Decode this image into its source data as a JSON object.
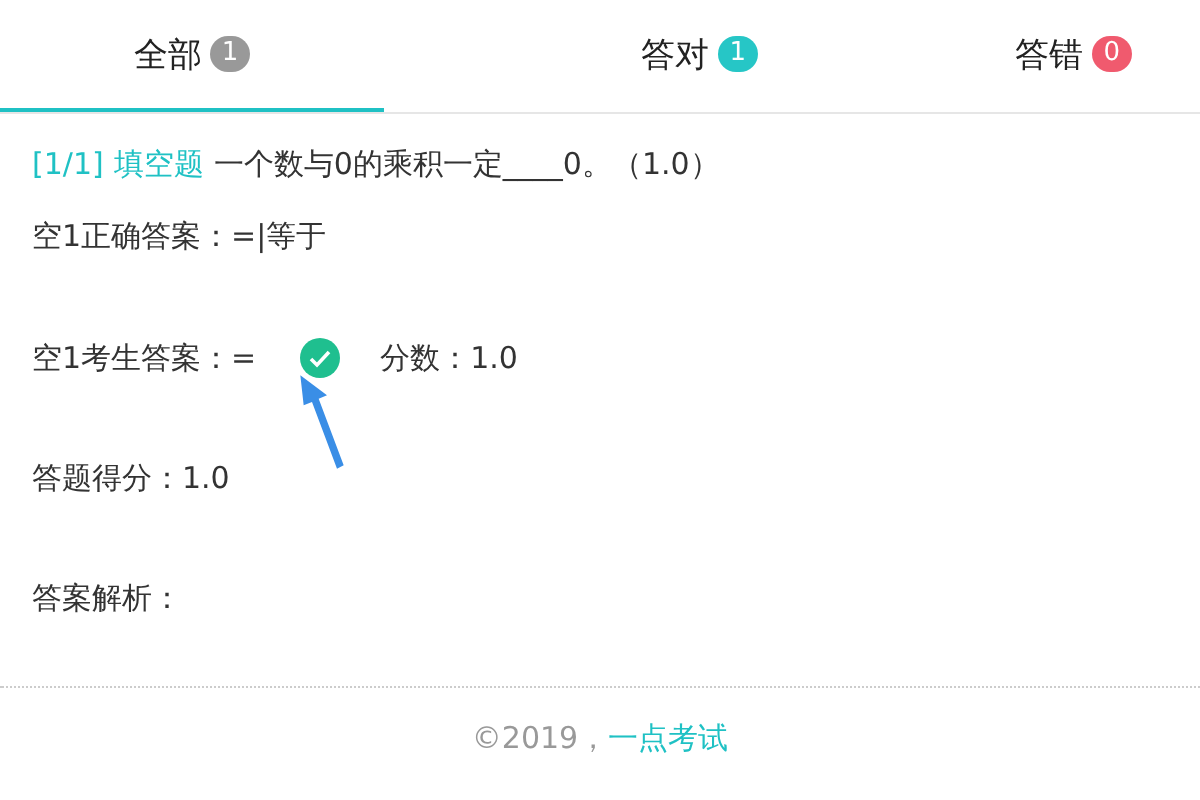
{
  "tabs": [
    {
      "label": "全部",
      "count": "1",
      "color": "#999999",
      "selected": true
    },
    {
      "label": "答对",
      "count": "1",
      "color": "#26c6c6",
      "selected": false
    },
    {
      "label": "答错",
      "count": "0",
      "color": "#f05a6e",
      "selected": false
    }
  ],
  "question": {
    "index": "[1/1]",
    "type": "填空题",
    "text": "一个数与0的乘积一定____0。（1.0）"
  },
  "correct_answer": "空1正确答案：=|等于",
  "student_answer": {
    "label": "空1考生答案：=",
    "correct": true,
    "score": "分数：1.0"
  },
  "total_score": "答题得分：1.0",
  "analysis": "答案解析：",
  "footer": {
    "copyright": "©2019，",
    "link": "一点考试"
  }
}
